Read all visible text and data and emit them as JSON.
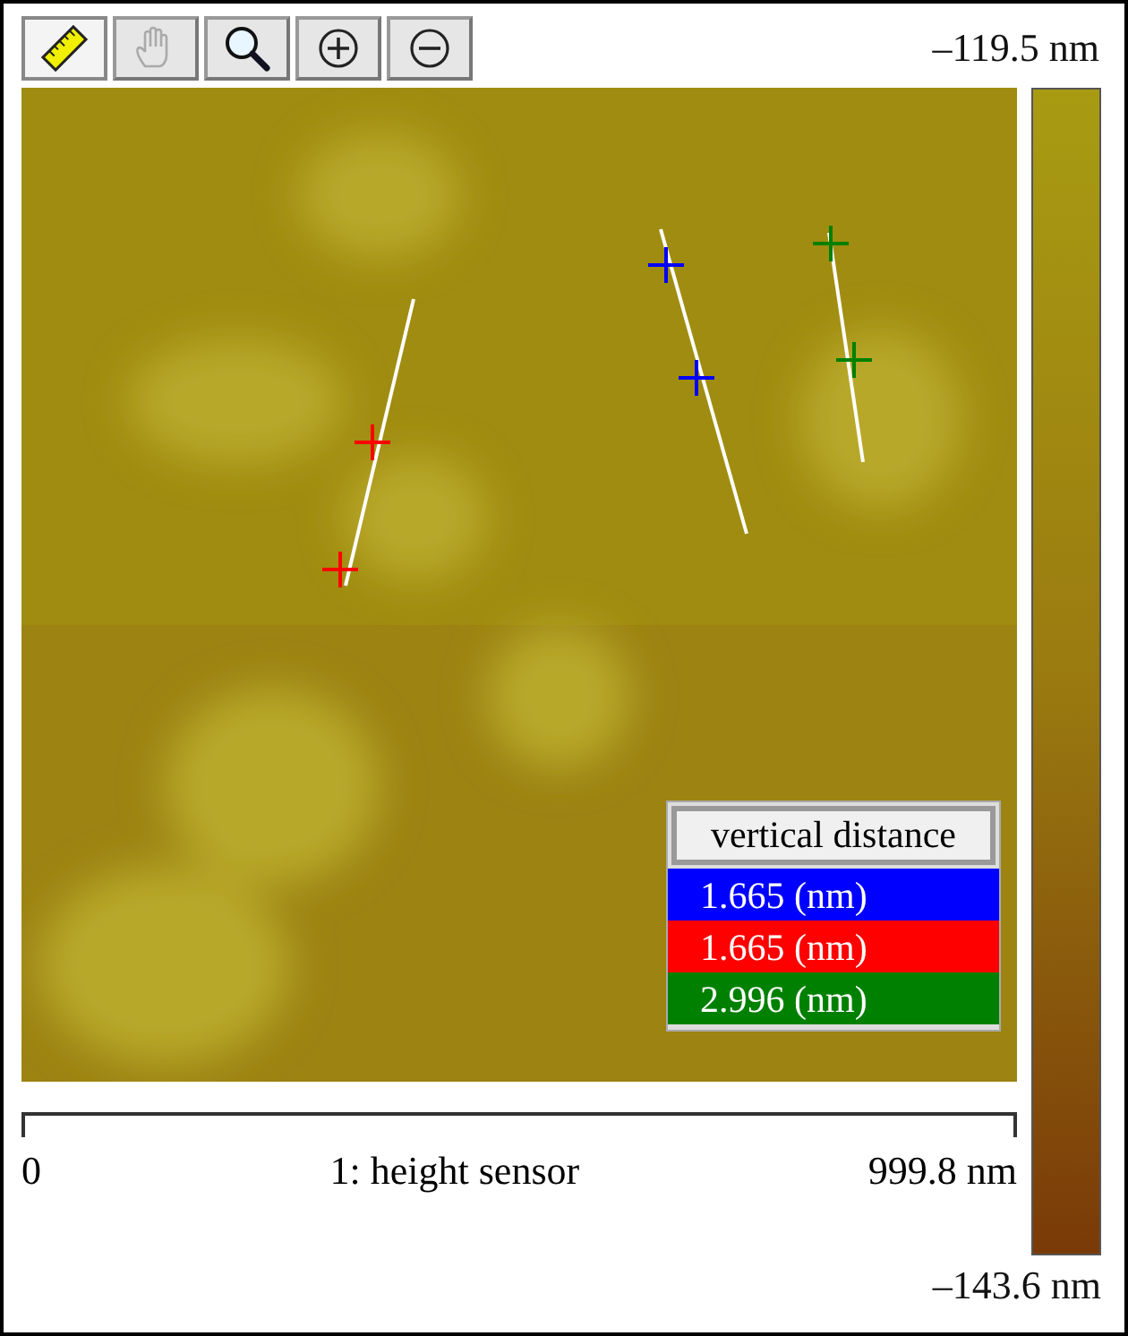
{
  "toolbar": [
    {
      "kind": "ruler",
      "selected": true,
      "disabled": false
    },
    {
      "kind": "hand",
      "selected": false,
      "disabled": true
    },
    {
      "kind": "magnifier",
      "selected": false,
      "disabled": false
    },
    {
      "kind": "zoom-in",
      "selected": false,
      "disabled": false
    },
    {
      "kind": "zoom-out",
      "selected": false,
      "disabled": false
    }
  ],
  "color_scale": {
    "max_label": "–119.5 nm",
    "min_label": "–143.6 nm"
  },
  "measurements": {
    "header": "vertical distance",
    "readings": [
      {
        "value": "1.665 (nm)",
        "color": "#0000ff"
      },
      {
        "value": "1.665 (nm)",
        "color": "#ff0000"
      },
      {
        "value": "2.996 (nm)",
        "color": "#008000"
      }
    ]
  },
  "scale_bar": {
    "start_label": "0",
    "channel_label": "1: height sensor",
    "end_label": "999.8 nm"
  }
}
